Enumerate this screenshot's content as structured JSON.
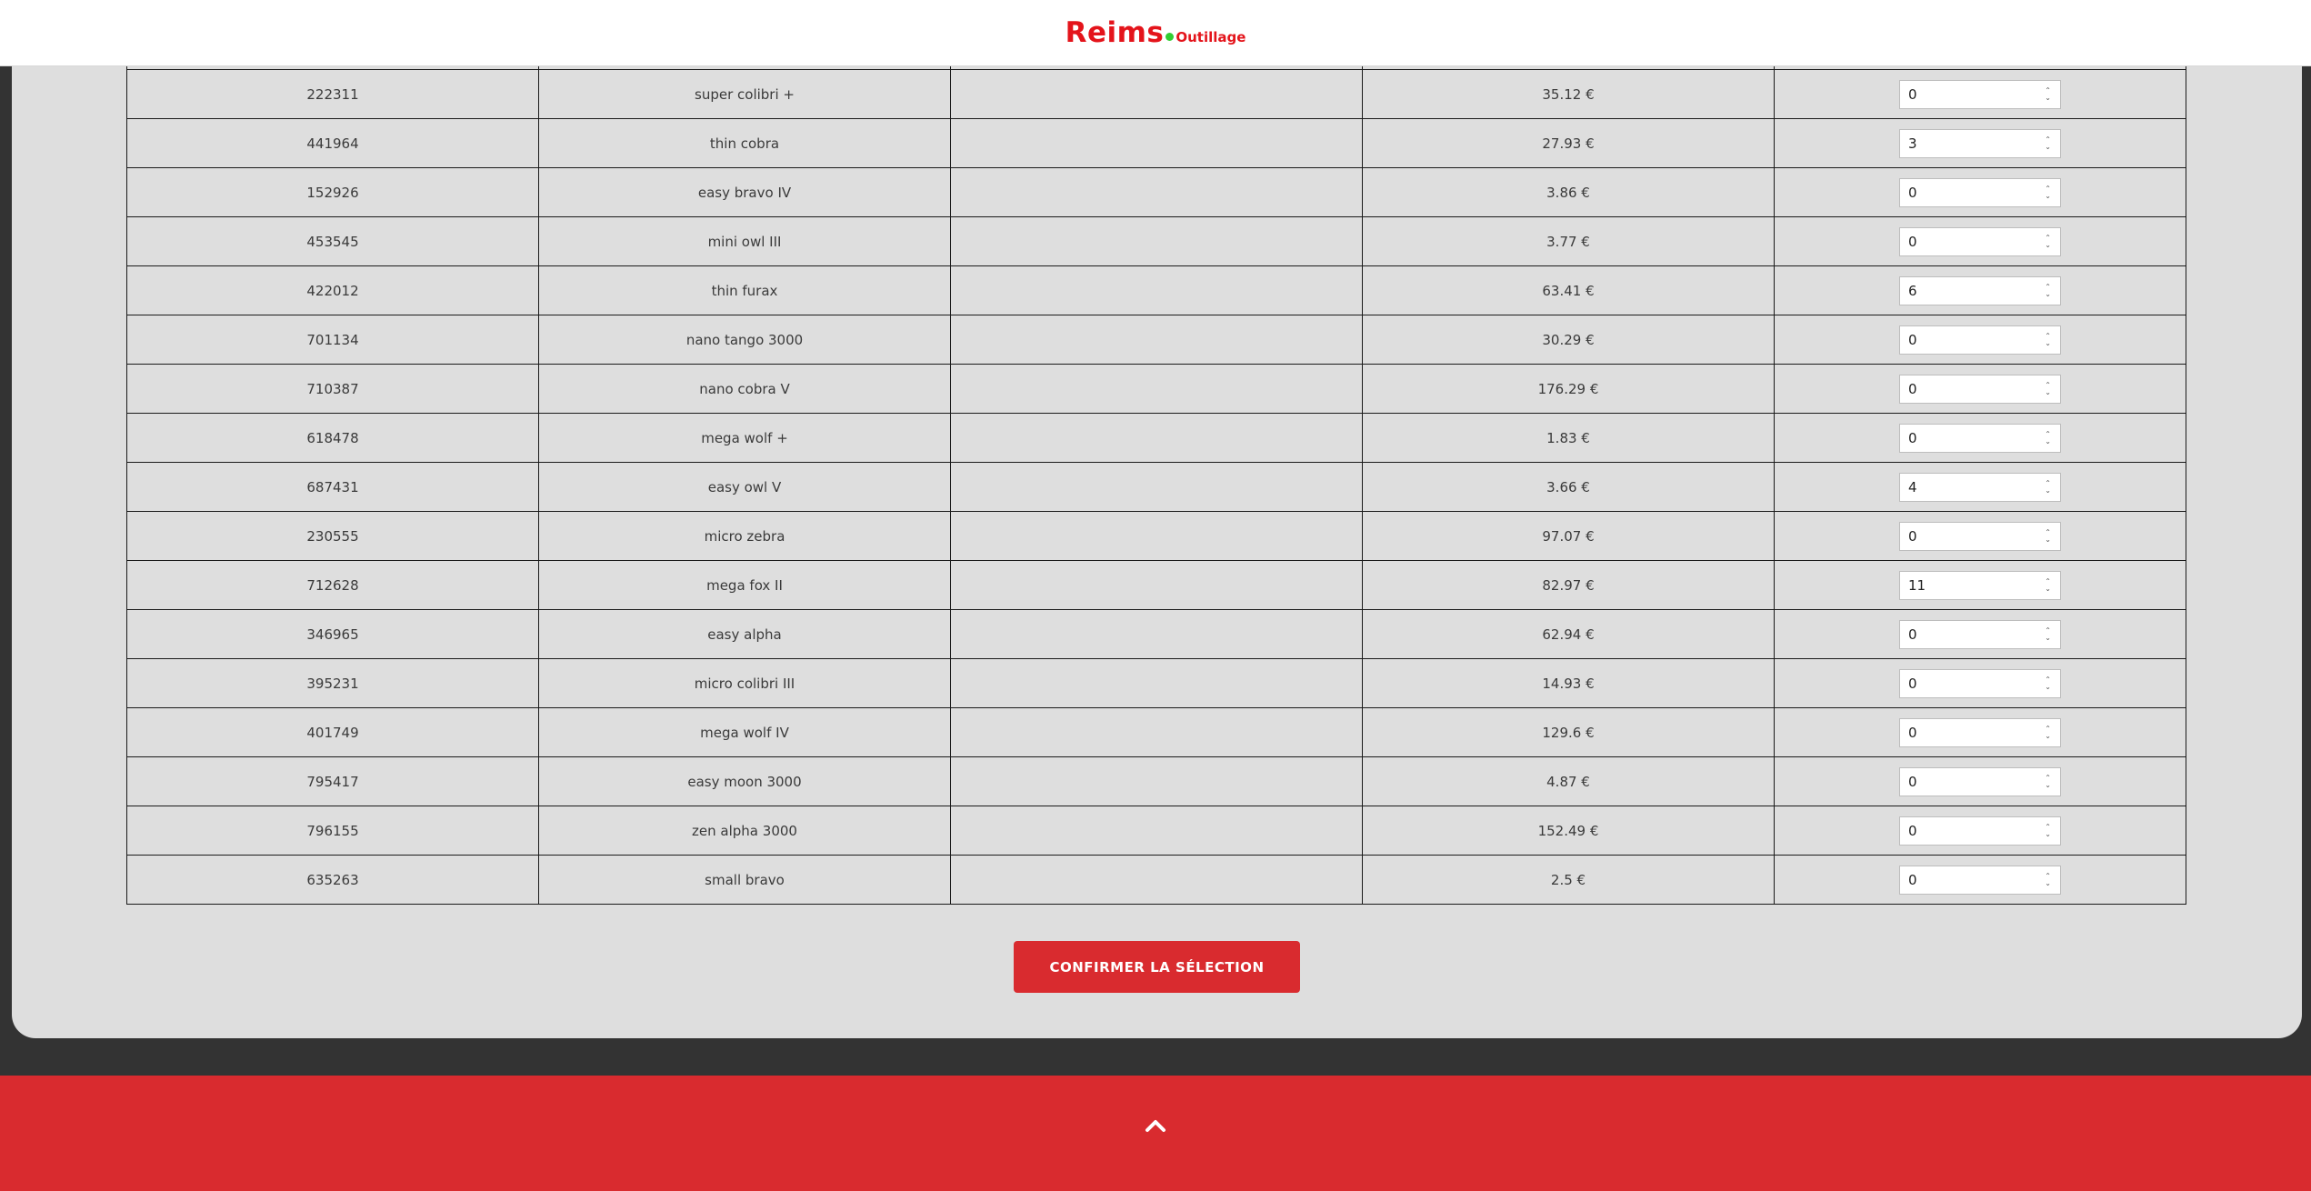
{
  "header": {
    "logo_main": "Reims",
    "logo_sub": "Outillage"
  },
  "products": [
    {
      "ref": "222311",
      "name": "super colibri +",
      "price": "35.12 €",
      "qty": "0"
    },
    {
      "ref": "441964",
      "name": "thin cobra",
      "price": "27.93 €",
      "qty": "3"
    },
    {
      "ref": "152926",
      "name": "easy bravo IV",
      "price": "3.86 €",
      "qty": "0"
    },
    {
      "ref": "453545",
      "name": "mini owl III",
      "price": "3.77 €",
      "qty": "0"
    },
    {
      "ref": "422012",
      "name": "thin furax",
      "price": "63.41 €",
      "qty": "6"
    },
    {
      "ref": "701134",
      "name": "nano tango 3000",
      "price": "30.29 €",
      "qty": "0"
    },
    {
      "ref": "710387",
      "name": "nano cobra V",
      "price": "176.29 €",
      "qty": "0"
    },
    {
      "ref": "618478",
      "name": "mega wolf +",
      "price": "1.83 €",
      "qty": "0"
    },
    {
      "ref": "687431",
      "name": "easy owl V",
      "price": "3.66 €",
      "qty": "4"
    },
    {
      "ref": "230555",
      "name": "micro zebra",
      "price": "97.07 €",
      "qty": "0"
    },
    {
      "ref": "712628",
      "name": "mega fox II",
      "price": "82.97 €",
      "qty": "11"
    },
    {
      "ref": "346965",
      "name": "easy alpha",
      "price": "62.94 €",
      "qty": "0"
    },
    {
      "ref": "395231",
      "name": "micro colibri III",
      "price": "14.93 €",
      "qty": "0"
    },
    {
      "ref": "401749",
      "name": "mega wolf IV",
      "price": "129.6 €",
      "qty": "0"
    },
    {
      "ref": "795417",
      "name": "easy moon 3000",
      "price": "4.87 €",
      "qty": "0"
    },
    {
      "ref": "796155",
      "name": "zen alpha 3000",
      "price": "152.49 €",
      "qty": "0"
    },
    {
      "ref": "635263",
      "name": "small bravo",
      "price": "2.5 €",
      "qty": "0"
    }
  ],
  "confirm_label": "CONFIRMER LA SÉLECTION",
  "footer": {
    "scroll_top_icon": "chevron-up-icon"
  },
  "colors": {
    "brand_red": "#e4141b",
    "button_red": "#d92b2f",
    "logo_dot_green": "#32cd32",
    "panel_bg": "#dedede",
    "page_bg": "#333333"
  }
}
